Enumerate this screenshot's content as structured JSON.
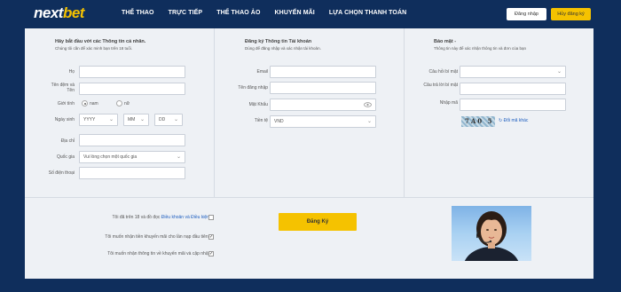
{
  "header": {
    "logo_part1": "next",
    "logo_part2": "bet",
    "nav": [
      "THỂ THAO",
      "TRỰC TIẾP",
      "THỂ THAO ẢO",
      "KHUYẾN MÃI",
      "LỰA CHỌN THANH TOÁN"
    ],
    "login_label": "Đăng nhập",
    "register_label": "Hủy đăng ký"
  },
  "personal": {
    "title": "Hãy bắt đầu với các Thông tin cá nhân.",
    "subtitle": "Chúng tôi cần để xác minh bạn trên 18 tuổi.",
    "last_name_label": "Họ",
    "first_name_label": "Tên đệm và Tên",
    "gender_label": "Giới tính",
    "gender_male": "nam",
    "gender_female": "nữ",
    "dob_label": "Ngày sinh",
    "year_placeholder": "YYYY",
    "month_placeholder": "MM",
    "day_placeholder": "DD",
    "address_label": "Địa chỉ",
    "country_label": "Quốc gia",
    "country_value": "Vui lòng chọn một quốc gia",
    "phone_label": "Số điện thoại"
  },
  "account": {
    "title": "Đăng ký Thông tin Tài khoản",
    "subtitle": "Dùng để đăng nhập và xác nhận tài khoản.",
    "email_label": "Email",
    "username_label": "Tên đăng nhập",
    "password_label": "Mật Khẩu",
    "currency_label": "Tiền tệ",
    "currency_value": "VND"
  },
  "security": {
    "title": "Bảo mật -",
    "subtitle": "Thông tin này để xác nhận thông tin và đơn của bạn",
    "question_label": "Câu hỏi bí mật",
    "answer_label": "Câu trả lời bí mật",
    "code_label": "Nhập mã",
    "captcha_text": "7A0 5",
    "change_code": "Đổi mã khác"
  },
  "consent": {
    "terms_prefix": "Tôi đã trên 18 và đồ đọc ",
    "terms_link": "Điều khoản và Điều kiện",
    "bonus": "Tôi muốn nhận tiền khuyến mãi cho lần nạp đầu tiên.",
    "news": "Tôi muốn nhận thông tin về khuyến mãi và cập nhật",
    "submit": "Đăng Ký"
  }
}
